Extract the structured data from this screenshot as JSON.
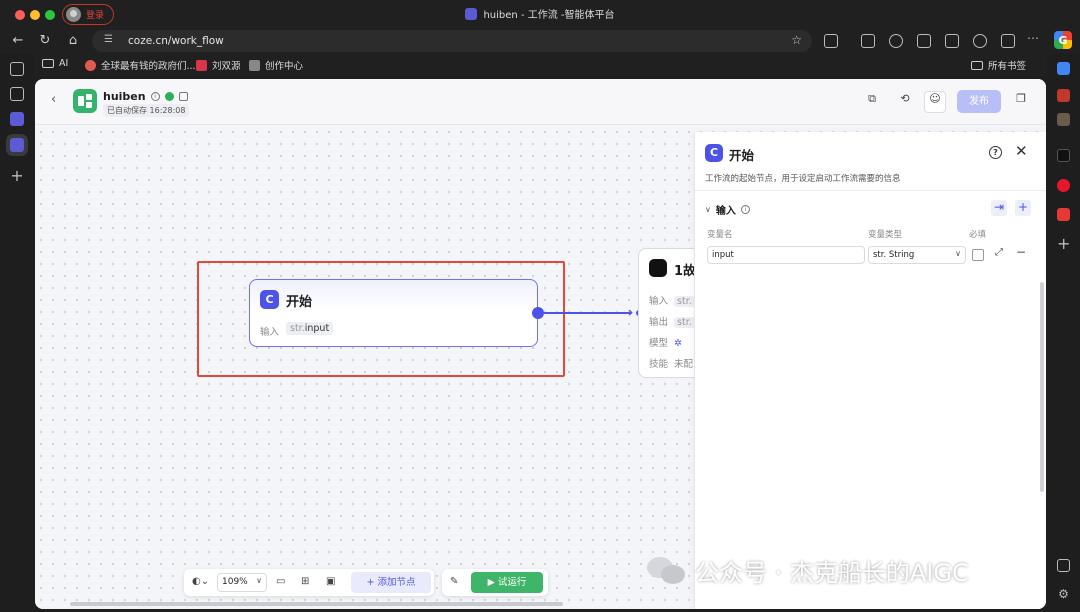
{
  "browser": {
    "window_title": "huiben - 工作流 -智能体平台",
    "profile_label": "登录",
    "url": "coze.cn/work_flow",
    "bookmarks": [
      {
        "label": "AI"
      },
      {
        "label": "全球最有钱的政府们..."
      },
      {
        "label": "刘双源"
      },
      {
        "label": "创作中心"
      },
      {
        "label": "所有书签"
      }
    ],
    "google_glyph": "G"
  },
  "header": {
    "app_name": "huiben",
    "autosave": "已自动保存 16:28:08",
    "publish_label": "发布"
  },
  "canvas": {
    "start_node": {
      "title": "开始",
      "input_label": "输入",
      "input_type": "str.",
      "input_name": "input"
    },
    "llm_node": {
      "title": "1故",
      "rows": [
        {
          "label": "输入",
          "tag": "str."
        },
        {
          "label": "输出",
          "tag": "str."
        },
        {
          "label": "模型",
          "tag": ""
        },
        {
          "label": "技能",
          "tag": "未配"
        }
      ]
    }
  },
  "panel": {
    "title": "开始",
    "description": "工作流的起始节点，用于设定启动工作流需要的信息",
    "section_label": "输入",
    "col_name": "变量名",
    "col_type": "变量类型",
    "col_required": "必填",
    "var_name": "input",
    "var_type": "str. String"
  },
  "toolbar": {
    "zoom": "109%",
    "add_node_label": "添加节点",
    "run_label": "试运行"
  },
  "watermark": "公众号 · 杰克船长的AIGC"
}
